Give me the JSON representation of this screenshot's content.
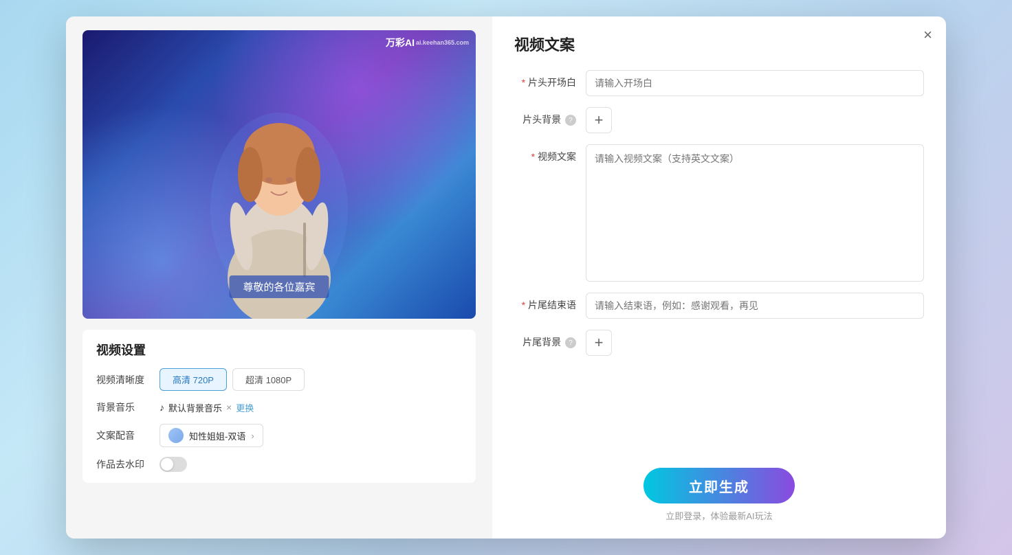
{
  "modal": {
    "close_label": "×",
    "right_title": "视频文案"
  },
  "video_preview": {
    "subtitle": "尊敬的各位嘉宾",
    "watermark_text": "万彩AI",
    "watermark_subtext": "ai.keehan365.com"
  },
  "settings": {
    "title": "视频设置",
    "quality_label": "视频清晰度",
    "quality_options": [
      {
        "label": "高清 720P",
        "active": true
      },
      {
        "label": "超清 1080P",
        "active": false
      }
    ],
    "music_label": "背景音乐",
    "music_name": "默认背景音乐",
    "music_change": "更换",
    "voice_label": "文案配音",
    "voice_name": "知性姐姐-双语",
    "watermark_label": "作品去水印",
    "watermark_on": false
  },
  "form": {
    "opening_label": "片头开场白",
    "opening_placeholder": "请输入开场白",
    "opening_required": true,
    "bg_label": "片头背景",
    "bg_plus": "+",
    "script_label": "视频文案",
    "script_placeholder": "请输入视频文案（支持英文文案）",
    "script_required": true,
    "ending_label": "片尾结束语",
    "ending_placeholder": "请输入结束语，例如：感谢观看，再见",
    "ending_required": true,
    "ending_bg_label": "片尾背景",
    "ending_bg_plus": "+"
  },
  "actions": {
    "generate_label": "立即生成",
    "hint_text": "立即登录，体验最新AI玩法"
  }
}
